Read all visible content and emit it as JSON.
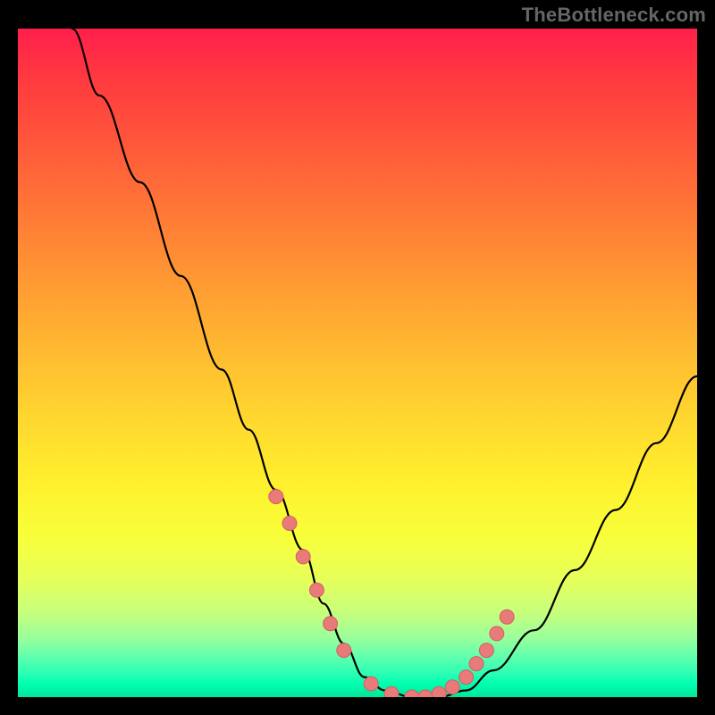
{
  "watermark": "TheBottleneck.com",
  "chart_data": {
    "type": "line",
    "title": "",
    "xlabel": "",
    "ylabel": "",
    "xlim": [
      0,
      100
    ],
    "ylim": [
      0,
      100
    ],
    "grid": false,
    "legend": false,
    "series": [
      {
        "name": "bottleneck-curve",
        "x": [
          8,
          12,
          18,
          24,
          30,
          34,
          38,
          42,
          45,
          48,
          51,
          54,
          58,
          62,
          66,
          70,
          76,
          82,
          88,
          94,
          100
        ],
        "values": [
          100,
          90,
          77,
          63,
          49,
          40,
          31,
          22,
          14,
          8,
          3,
          1,
          0,
          0,
          1,
          4,
          10,
          19,
          28,
          38,
          48
        ]
      }
    ],
    "highlighted_points": {
      "name": "marker-dots",
      "x": [
        38,
        40,
        42,
        44,
        46,
        48,
        52,
        55,
        58,
        60,
        62,
        64,
        66,
        67.5,
        69,
        70.5,
        72
      ],
      "values": [
        30,
        26,
        21,
        16,
        11,
        7,
        2,
        0.5,
        0,
        0,
        0.5,
        1.5,
        3,
        5,
        7,
        9.5,
        12
      ]
    },
    "background_gradient": {
      "top": "#ff1f4b",
      "upper_mid": "#ff9a33",
      "mid": "#ffe92f",
      "lower": "#a8ff88",
      "bottom": "#00e69a"
    }
  }
}
